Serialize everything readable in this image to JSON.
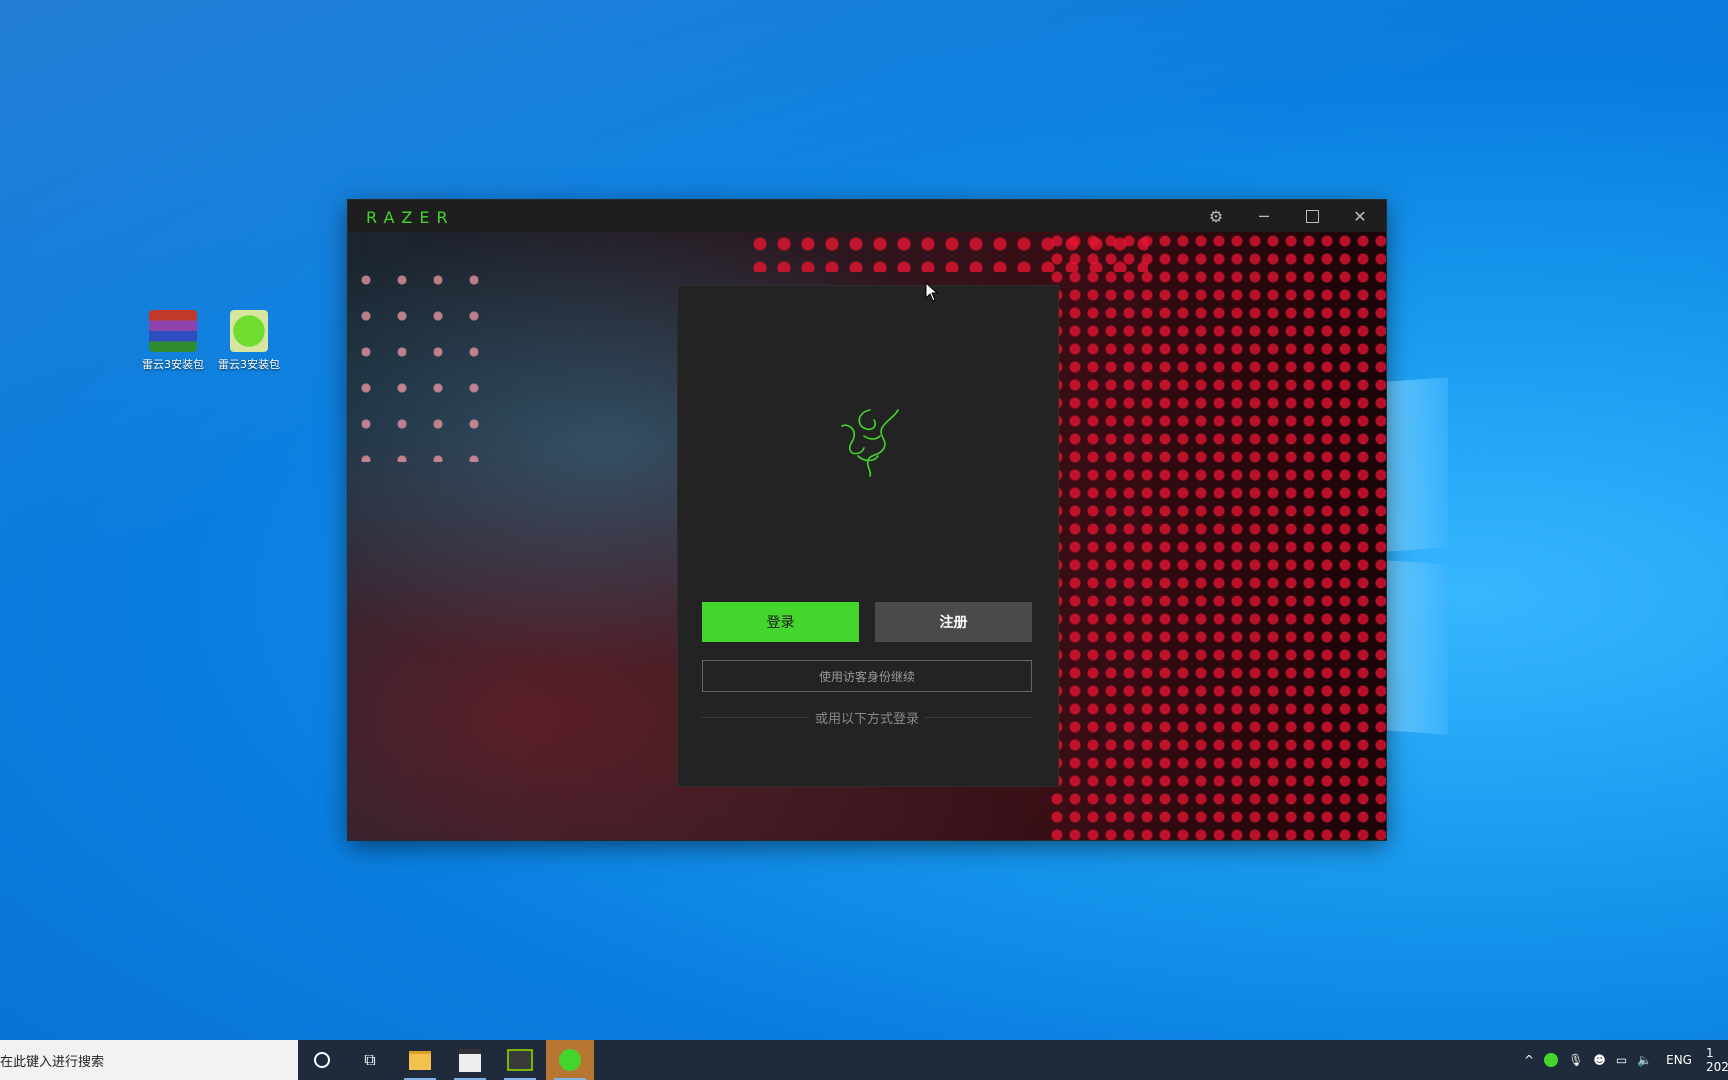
{
  "desktop": {
    "icons": [
      {
        "label": "雷云3安装包"
      },
      {
        "label": "雷云3安装包"
      }
    ]
  },
  "window": {
    "brand": "RAZER",
    "icons": {
      "settings": "gear-icon",
      "minimize": "minimize-icon",
      "maximize": "maximize-icon",
      "close": "close-icon"
    }
  },
  "login": {
    "login_label": "登录",
    "register_label": "注册",
    "guest_label": "使用访客身份继续",
    "alt_login_label": "或用以下方式登录"
  },
  "taskbar": {
    "search_placeholder": "在此键入进行搜索",
    "language": "ENG",
    "clock_partial": "1",
    "date_partial": "202"
  },
  "colors": {
    "razer_green": "#44d62c",
    "panel_bg": "#222322",
    "register_bg": "#4a4a4a"
  }
}
